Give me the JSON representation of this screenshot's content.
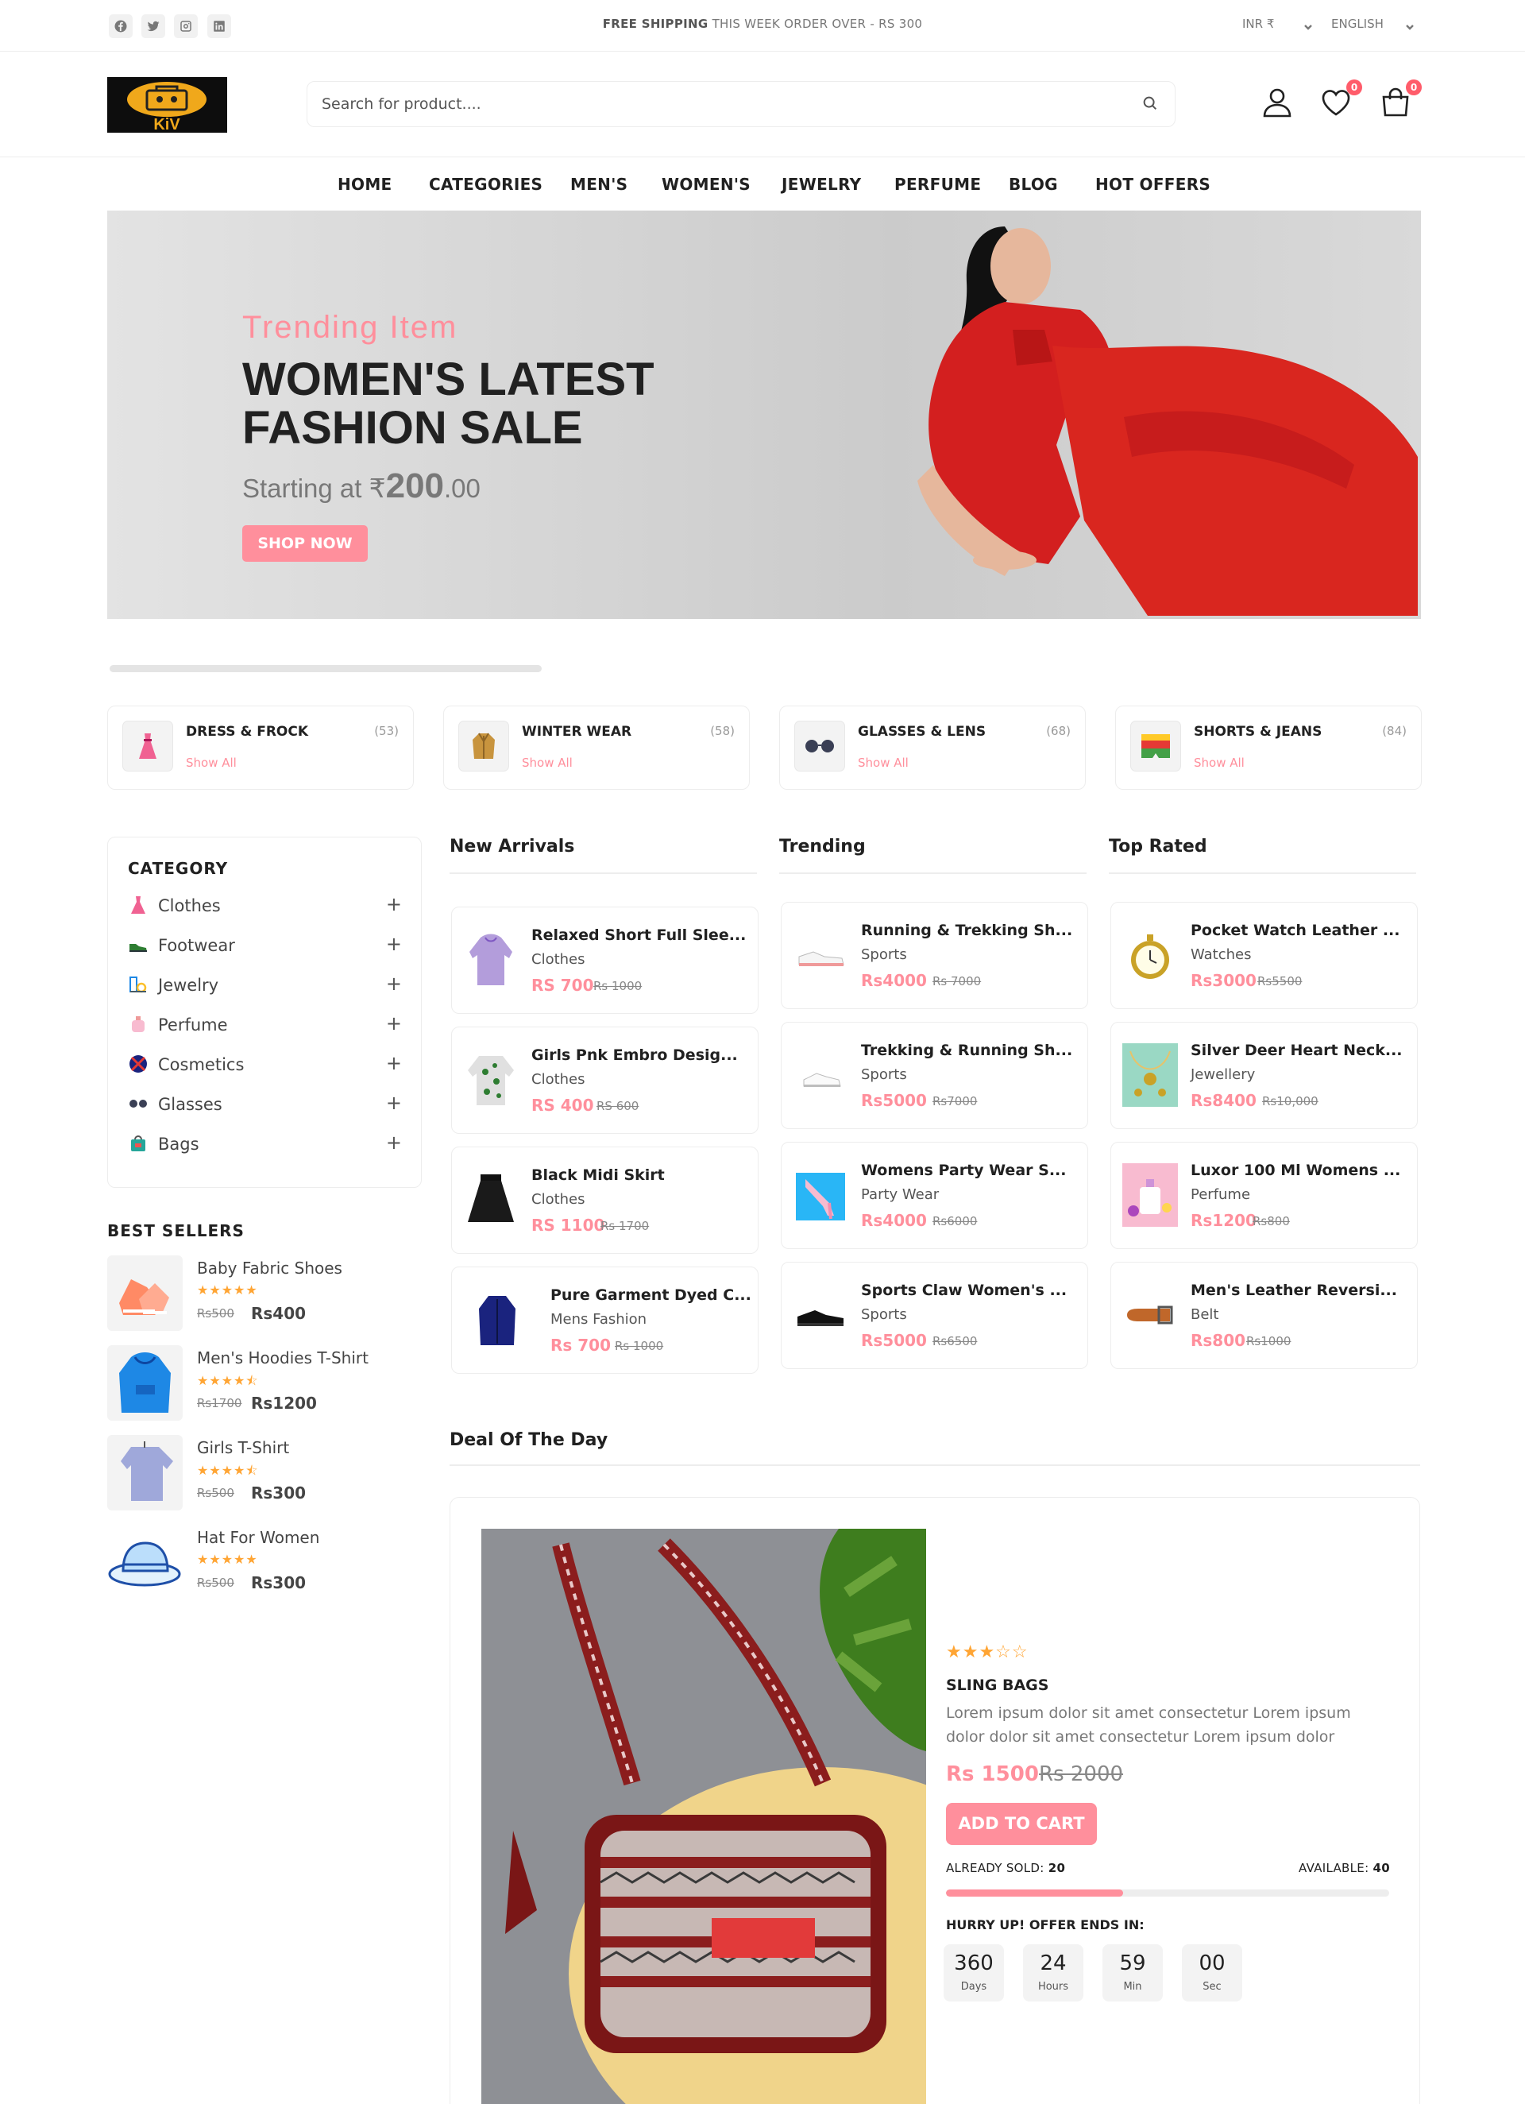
{
  "topbar": {
    "shipping_bold": "FREE SHIPPING",
    "shipping_rest": "THIS WEEK ORDER OVER - RS 300",
    "currency": "INR ₹",
    "language": "ENGLISH"
  },
  "logo": {
    "text": "KiV"
  },
  "search": {
    "placeholder": "Search for product...."
  },
  "header": {
    "wishlist_count": "0",
    "cart_count": "0"
  },
  "nav": [
    "HOME",
    "CATEGORIES",
    "MEN'S",
    "WOMEN'S",
    "JEWELRY",
    "PERFUME",
    "BLOG",
    "HOT OFFERS"
  ],
  "hero": {
    "subtitle": "Trending Item",
    "title_line1": "WOMEN'S LATEST",
    "title_line2": "FASHION SALE",
    "price_prefix": "Starting at ₹",
    "price_whole": "200",
    "price_dec": ".00",
    "button": "SHOP NOW"
  },
  "category_cards": [
    {
      "name": "DRESS & FROCK",
      "count": "(53)",
      "link": "Show All",
      "icon": "dress-icon"
    },
    {
      "name": "WINTER WEAR",
      "count": "(58)",
      "link": "Show All",
      "icon": "coat-icon"
    },
    {
      "name": "GLASSES & LENS",
      "count": "(68)",
      "link": "Show All",
      "icon": "glasses-icon"
    },
    {
      "name": "SHORTS & JEANS",
      "count": "(84)",
      "link": "Show All",
      "icon": "shorts-icon"
    }
  ],
  "sidebar": {
    "title": "CATEGORY",
    "items": [
      {
        "label": "Clothes",
        "icon": "dress-icon"
      },
      {
        "label": "Footwear",
        "icon": "shoe-icon"
      },
      {
        "label": "Jewelry",
        "icon": "jewelry-icon"
      },
      {
        "label": "Perfume",
        "icon": "perfume-icon"
      },
      {
        "label": "Cosmetics",
        "icon": "cosmetics-icon"
      },
      {
        "label": "Glasses",
        "icon": "glasses-icon"
      },
      {
        "label": "Bags",
        "icon": "bag-icon"
      }
    ]
  },
  "best_sellers": {
    "title": "BEST SELLERS",
    "items": [
      {
        "name": "Baby Fabric Shoes",
        "stars": "★★★★★",
        "old": "Rs500",
        "price": "Rs400"
      },
      {
        "name": "Men's Hoodies T-Shirt",
        "stars": "★★★★⯪",
        "old": "Rs1700",
        "price": "Rs1200"
      },
      {
        "name": "Girls T-Shirt",
        "stars": "★★★★⯪",
        "old": "Rs500",
        "price": "Rs300"
      },
      {
        "name": "Hat For Women",
        "stars": "★★★★★",
        "old": "Rs500",
        "price": "Rs300"
      }
    ]
  },
  "columns": [
    {
      "title": "New Arrivals",
      "products": [
        {
          "name": "Relaxed Short Full Slee...",
          "category": "Clothes",
          "price": "RS 700",
          "old": "Rs 1000"
        },
        {
          "name": "Girls Pnk Embro Desig...",
          "category": "Clothes",
          "price": "RS 400",
          "old": "RS 600"
        },
        {
          "name": "Black Midi Skirt",
          "category": "Clothes",
          "price": "RS 1100",
          "old": "Rs 1700"
        },
        {
          "name": "Pure Garment Dyed C...",
          "category": "Mens Fashion",
          "price": "Rs 700",
          "old": "Rs 1000"
        }
      ]
    },
    {
      "title": "Trending",
      "products": [
        {
          "name": "Running & Trekking Sh...",
          "category": "Sports",
          "price": "Rs4000",
          "old": "Rs 7000"
        },
        {
          "name": "Trekking & Running Sh...",
          "category": "Sports",
          "price": "Rs5000",
          "old": "Rs7000"
        },
        {
          "name": "Womens Party Wear S...",
          "category": "Party Wear",
          "price": "Rs4000",
          "old": "Rs6000"
        },
        {
          "name": "Sports Claw Women's ...",
          "category": "Sports",
          "price": "Rs5000",
          "old": "Rs6500"
        }
      ]
    },
    {
      "title": "Top Rated",
      "products": [
        {
          "name": "Pocket Watch Leather ...",
          "category": "Watches",
          "price": "Rs3000",
          "old": "Rs5500"
        },
        {
          "name": "Silver Deer Heart Neck...",
          "category": "Jewellery",
          "price": "Rs8400",
          "old": "Rs10,000"
        },
        {
          "name": "Luxor 100 Ml Womens ...",
          "category": "Perfume",
          "price": "Rs1200",
          "old": "Rs800"
        },
        {
          "name": "Men's Leather Reversi...",
          "category": "Belt",
          "price": "Rs800",
          "old": "Rs1000"
        }
      ]
    }
  ],
  "deal": {
    "title": "Deal Of The Day",
    "stars": "★★★☆☆",
    "name": "SLING BAGS",
    "description": "Lorem ipsum dolor sit amet consectetur Lorem ipsum dolor dolor sit amet consectetur Lorem ipsum dolor",
    "price": "Rs 1500",
    "old_price": "Rs 2000",
    "button": "ADD TO CART",
    "sold_label": "ALREADY SOLD:",
    "sold": "20",
    "available_label": "AVAILABLE:",
    "available": "40",
    "sold_fraction": 0.4,
    "hurry": "HURRY UP! OFFER ENDS IN:",
    "countdown": [
      {
        "value": "360",
        "unit": "Days"
      },
      {
        "value": "24",
        "unit": "Hours"
      },
      {
        "value": "59",
        "unit": "Min"
      },
      {
        "value": "00",
        "unit": "Sec"
      }
    ]
  },
  "colors": {
    "accent": "#ff8f9c",
    "star": "#ffa534",
    "badge": "#ff5c6a"
  }
}
